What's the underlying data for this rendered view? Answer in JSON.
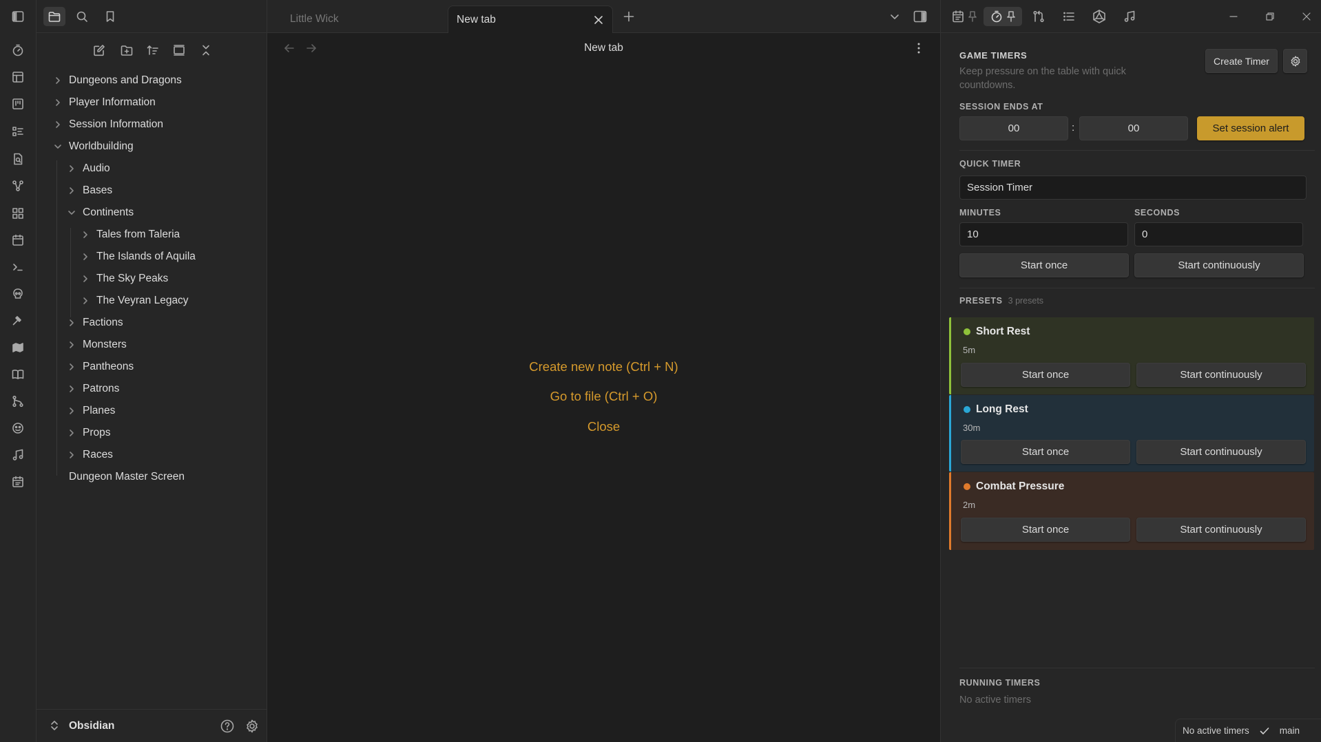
{
  "colors": {
    "accent": "#d69a2c",
    "alert_button": "#c89a2c",
    "preset_short": "#8fc23a",
    "preset_long": "#2aa7d6",
    "preset_combat": "#e07a2c"
  },
  "ribbon": {
    "icons": [
      "sidebar-toggle-icon",
      "timer-icon",
      "layout-icon",
      "kanban-icon",
      "checklist-icon",
      "file-search-icon",
      "graph-icon",
      "grid-icon",
      "calendar-icon",
      "terminal-icon",
      "skull-icon",
      "hammer-icon",
      "map-icon",
      "book-icon",
      "git-branch-icon",
      "dice-icon",
      "music-icon",
      "calendar-tasks-icon"
    ]
  },
  "explorer": {
    "tree": [
      {
        "label": "Dungeons and Dragons",
        "expanded": false
      },
      {
        "label": "Player Information",
        "expanded": false
      },
      {
        "label": "Session Information",
        "expanded": false
      },
      {
        "label": "Worldbuilding",
        "expanded": true
      },
      {
        "label": "Audio",
        "expanded": false
      },
      {
        "label": "Bases",
        "expanded": false
      },
      {
        "label": "Continents",
        "expanded": true
      },
      {
        "label": "Tales from Taleria",
        "expanded": false
      },
      {
        "label": "The Islands of Aquila",
        "expanded": false
      },
      {
        "label": "The Sky Peaks",
        "expanded": false
      },
      {
        "label": "The Veyran Legacy",
        "expanded": false
      },
      {
        "label": "Factions",
        "expanded": false
      },
      {
        "label": "Monsters",
        "expanded": false
      },
      {
        "label": "Pantheons",
        "expanded": false
      },
      {
        "label": "Patrons",
        "expanded": false
      },
      {
        "label": "Planes",
        "expanded": false
      },
      {
        "label": "Props",
        "expanded": false
      },
      {
        "label": "Races",
        "expanded": false
      },
      {
        "label": "Dungeon Master Screen",
        "expanded": false
      }
    ],
    "vault_name": "Obsidian"
  },
  "tabs": [
    {
      "label": "Little Wick",
      "active": false
    },
    {
      "label": "New tab",
      "active": true
    }
  ],
  "view": {
    "title": "New tab",
    "actions": [
      "Create new note (Ctrl + N)",
      "Go to file (Ctrl + O)",
      "Close"
    ]
  },
  "timers": {
    "title": "GAME TIMERS",
    "subtitle_line1": "Keep pressure on the table with quick",
    "subtitle_line2": "countdowns.",
    "create_label": "Create Timer",
    "session_label": "SESSION ENDS AT",
    "session_hours": "00",
    "session_separator": ":",
    "session_minutes": "00",
    "session_alert_label": "Set session alert",
    "quick_label": "QUICK TIMER",
    "quick_name": "Session Timer",
    "minutes_label": "MINUTES",
    "seconds_label": "SECONDS",
    "minutes_value": "10",
    "seconds_value": "0",
    "start_once": "Start once",
    "start_continuously": "Start continuously",
    "presets_label": "PRESETS",
    "presets_count": "3 presets",
    "presets": [
      {
        "name": "Short Rest",
        "duration": "5m"
      },
      {
        "name": "Long Rest",
        "duration": "30m"
      },
      {
        "name": "Combat Pressure",
        "duration": "2m"
      }
    ],
    "running_label": "RUNNING TIMERS",
    "running_empty": "No active timers"
  },
  "status": {
    "timers": "No active timers",
    "branch": "main"
  }
}
